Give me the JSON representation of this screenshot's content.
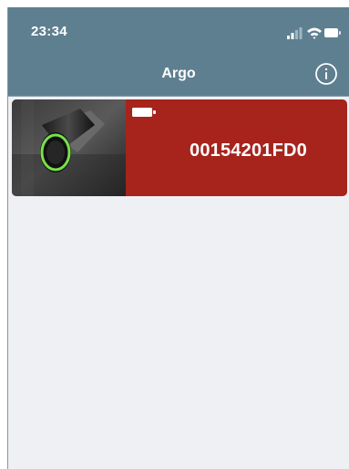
{
  "status_bar": {
    "time": "23:34",
    "icons": [
      "signal-icon",
      "wifi-icon",
      "battery-icon"
    ]
  },
  "header": {
    "title": "Argo",
    "info_icon": "info-icon"
  },
  "devices": [
    {
      "id": "00154201FD0",
      "image": "door-lock-cylinder",
      "battery_icon": "battery-full-icon",
      "color": "#a6241c"
    }
  ],
  "colors": {
    "header": "#5e7f8f",
    "background": "#eff0f4",
    "device_card": "#a6241c",
    "text": "#ffffff"
  }
}
